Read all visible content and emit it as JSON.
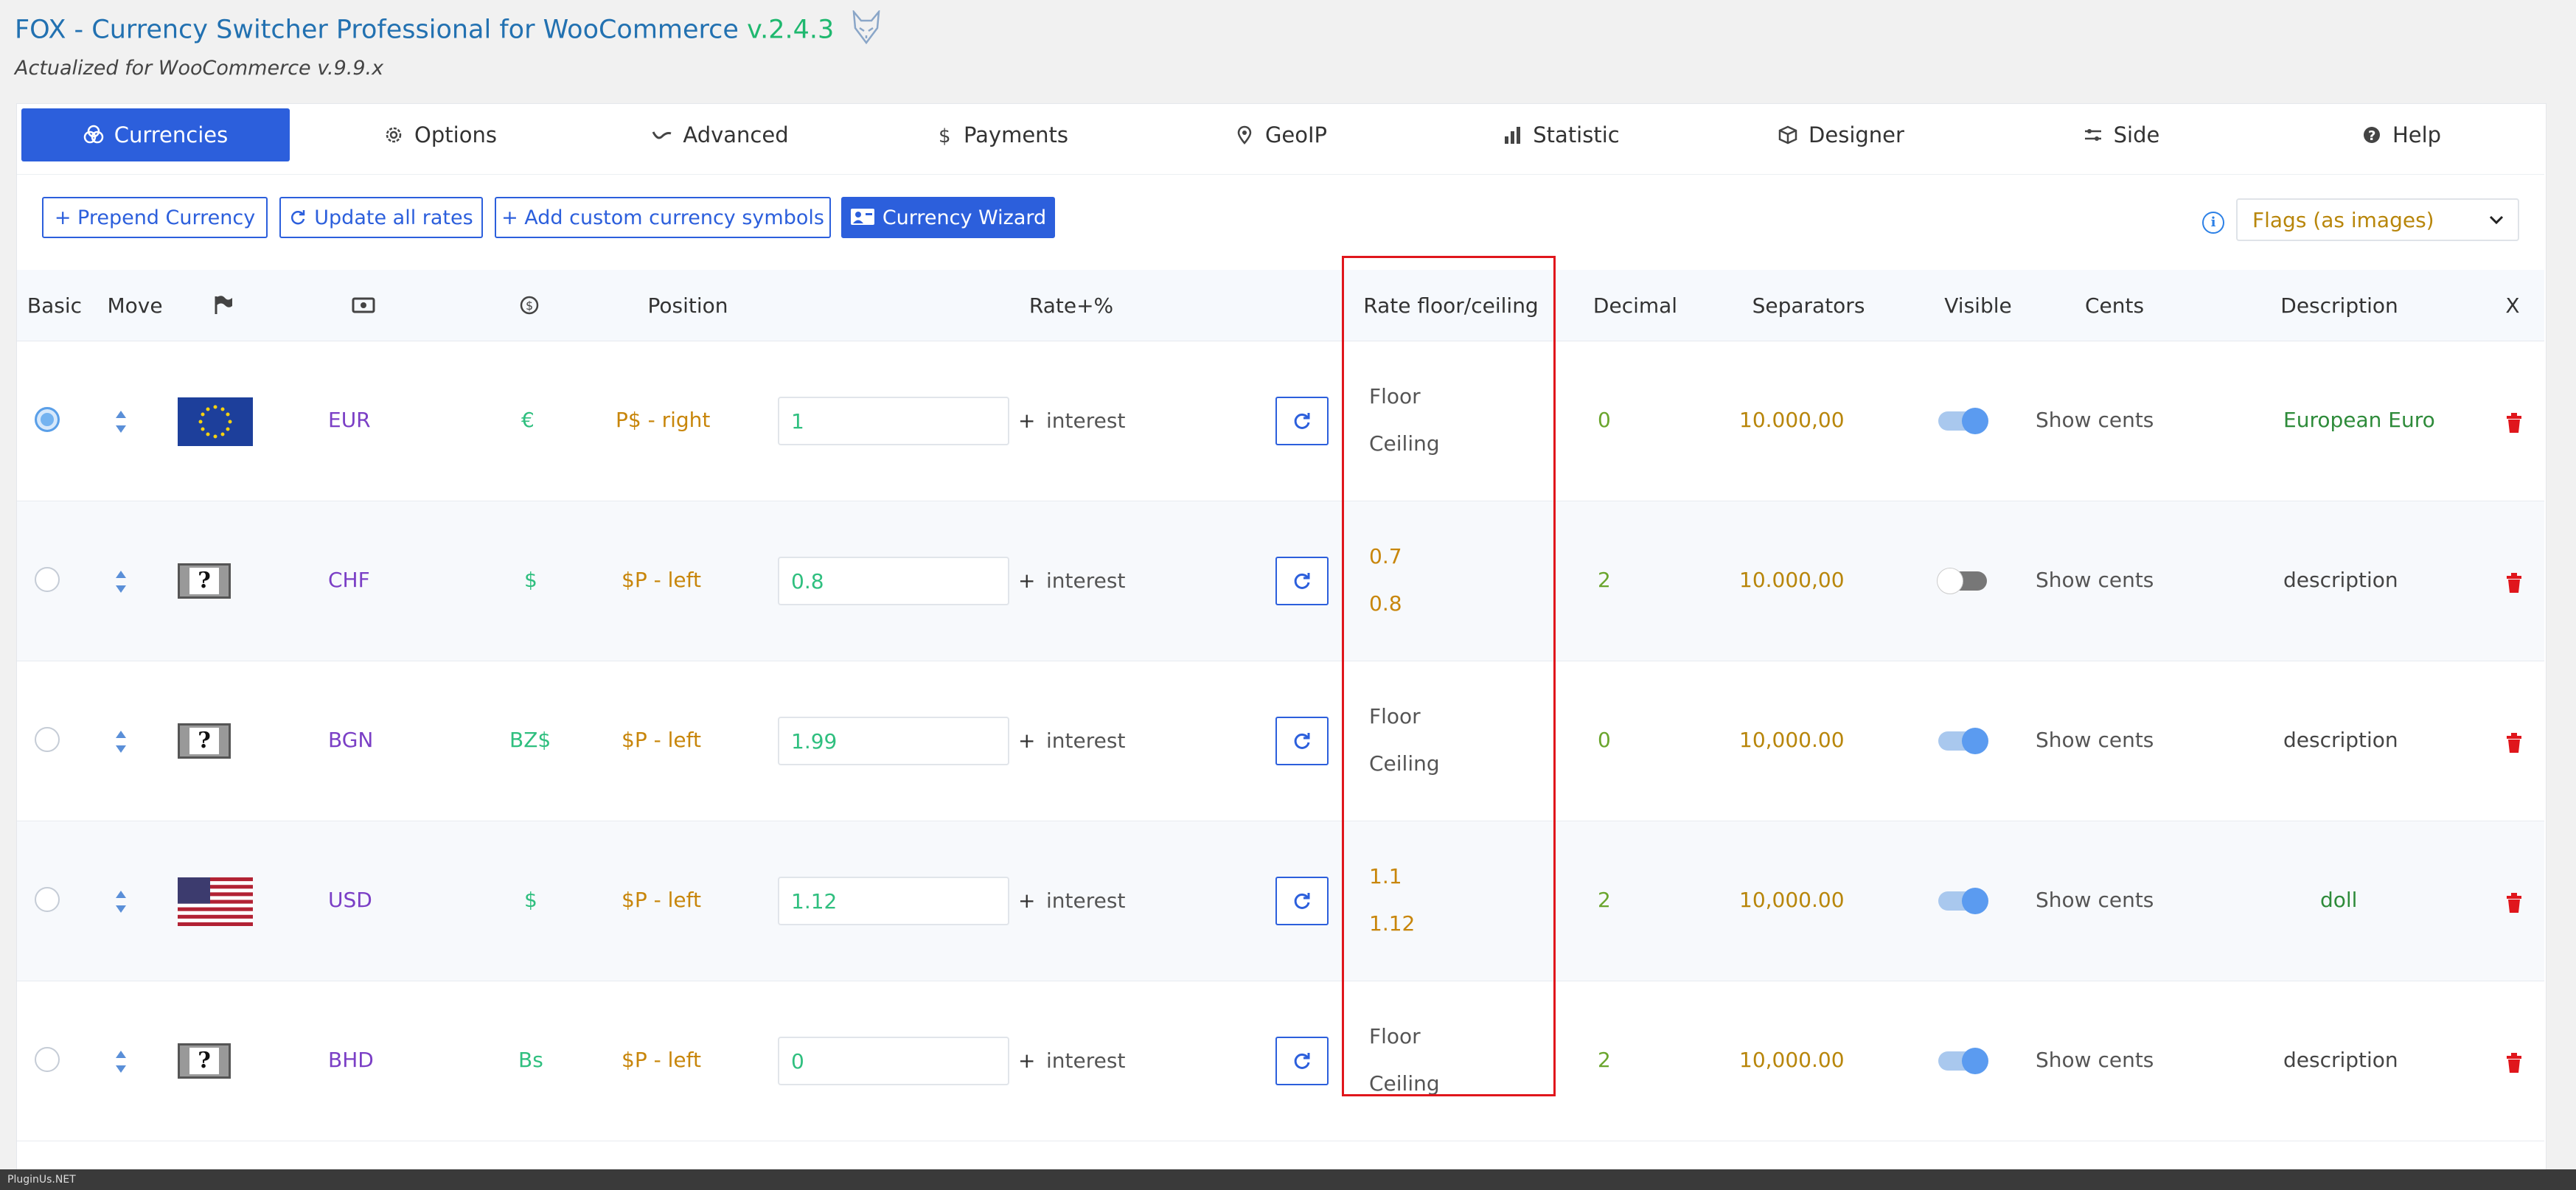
{
  "header": {
    "title": "FOX - Currency Switcher Professional for WooCommerce",
    "version": "v.2.4.3",
    "subtitle": "Actualized for WooCommerce v.9.9.x"
  },
  "tabs": [
    {
      "label": "Currencies",
      "icon": "coins-icon",
      "active": true
    },
    {
      "label": "Options",
      "icon": "gear-icon"
    },
    {
      "label": "Advanced",
      "icon": "wave-icon"
    },
    {
      "label": "Payments",
      "icon": "dollar-icon"
    },
    {
      "label": "GeoIP",
      "icon": "map-pin-icon"
    },
    {
      "label": "Statistic",
      "icon": "bar-chart-icon"
    },
    {
      "label": "Designer",
      "icon": "cube-icon"
    },
    {
      "label": "Side",
      "icon": "sliders-icon"
    },
    {
      "label": "Help",
      "icon": "question-circle-icon"
    }
  ],
  "toolbar": {
    "prepend": "+ Prepend Currency",
    "update_rates": "Update all rates",
    "add_symbols": "+ Add custom currency symbols",
    "wizard": "Currency Wizard",
    "flags_select": "Flags (as images)"
  },
  "columns": {
    "basic": "Basic",
    "move": "Move",
    "position": "Position",
    "rate": "Rate+%",
    "rate_floor": "Rate floor/ceiling",
    "decimal": "Decimal",
    "separators": "Separators",
    "visible": "Visible",
    "cents": "Cents",
    "description": "Description",
    "delete": "X"
  },
  "rows": [
    {
      "basic": true,
      "flag": "eu-flag",
      "code": "EUR",
      "symbol": "€",
      "position": "P$ - right",
      "rate": "1",
      "plus": "+",
      "interest": "interest",
      "floor": "Floor",
      "ceiling": "Ceiling",
      "floor_set": false,
      "decimal": "0",
      "separators": "10.000,00",
      "visible": true,
      "cents": "Show cents",
      "description": "European Euro",
      "desc_custom": true
    },
    {
      "basic": false,
      "flag": "unknown-flag",
      "code": "CHF",
      "symbol": "$",
      "position": "$P - left",
      "rate": "0.8",
      "plus": "+",
      "interest": "interest",
      "floor": "0.7",
      "ceiling": "0.8",
      "floor_set": true,
      "decimal": "2",
      "separators": "10.000,00",
      "visible": false,
      "cents": "Show cents",
      "description": "description",
      "desc_custom": false
    },
    {
      "basic": false,
      "flag": "unknown-flag",
      "code": "BGN",
      "symbol": "BZ$",
      "position": "$P - left",
      "rate": "1.99",
      "plus": "+",
      "interest": "interest",
      "floor": "Floor",
      "ceiling": "Ceiling",
      "floor_set": false,
      "decimal": "0",
      "separators": "10,000.00",
      "visible": true,
      "cents": "Show cents",
      "description": "description",
      "desc_custom": false
    },
    {
      "basic": false,
      "flag": "us-flag",
      "code": "USD",
      "symbol": "$",
      "position": "$P - left",
      "rate": "1.12",
      "plus": "+",
      "interest": "interest",
      "floor": "1.1",
      "ceiling": "1.12",
      "floor_set": true,
      "decimal": "2",
      "separators": "10,000.00",
      "visible": true,
      "cents": "Show cents",
      "description": "doll",
      "desc_custom": true
    },
    {
      "basic": false,
      "flag": "unknown-flag",
      "code": "BHD",
      "symbol": "Bs",
      "position": "$P - left",
      "rate": "0",
      "plus": "+",
      "interest": "interest",
      "floor": "Floor",
      "ceiling": "Ceiling",
      "floor_set": false,
      "decimal": "2",
      "separators": "10,000.00",
      "visible": true,
      "cents": "Show cents",
      "description": "description",
      "desc_custom": false
    }
  ],
  "footer": "PluginUs.NET",
  "colors": {
    "accent": "#2c5fdc",
    "highlight": "#e0161c",
    "code": "#7b3fc6",
    "symbol": "#2fbf7f"
  }
}
